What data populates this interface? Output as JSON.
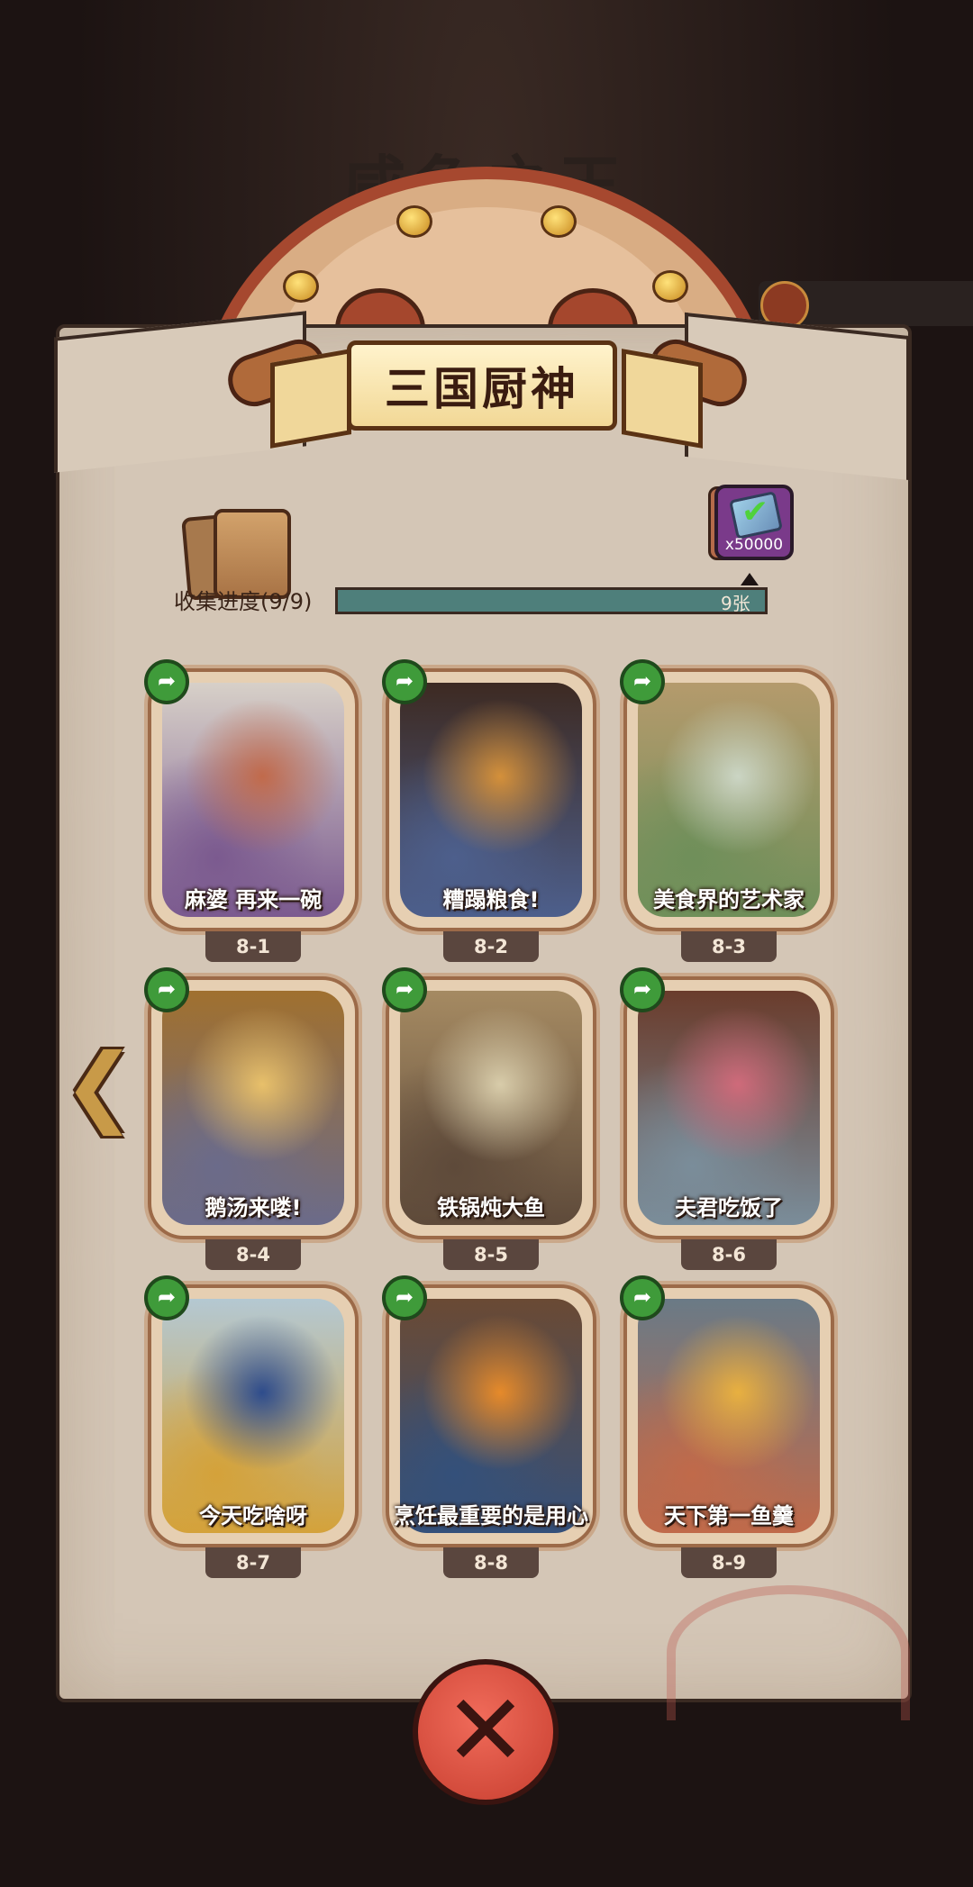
{
  "background_title": "咸鱼之王",
  "title": "三国厨神",
  "progress": {
    "label": "收集进度(9/9)",
    "collected": 9,
    "total": 9,
    "count_text": "9张",
    "reward_quantity": "x50000"
  },
  "cards": [
    {
      "caption": "麻婆 再来一碗",
      "number": "8-1",
      "art_colors": [
        "#d7d0c8",
        "#c16a4b",
        "#7b5a8f"
      ]
    },
    {
      "caption": "糟蹋粮食!",
      "number": "8-2",
      "art_colors": [
        "#3d2a22",
        "#d4903a",
        "#4d5f8c"
      ]
    },
    {
      "caption": "美食界的艺术家",
      "number": "8-3",
      "art_colors": [
        "#b49a6c",
        "#cbd5c4",
        "#6f8f5a"
      ]
    },
    {
      "caption": "鹅汤来喽!",
      "number": "8-4",
      "art_colors": [
        "#a0702f",
        "#e8c06a",
        "#6b6b8a"
      ]
    },
    {
      "caption": "铁锅炖大鱼",
      "number": "8-5",
      "art_colors": [
        "#a58a62",
        "#d8ccaa",
        "#5e4a3a"
      ]
    },
    {
      "caption": "夫君吃饭了",
      "number": "8-6",
      "art_colors": [
        "#6a3c2c",
        "#cf6a7a",
        "#7a8d9a"
      ]
    },
    {
      "caption": "今天吃啥呀",
      "number": "8-7",
      "art_colors": [
        "#b4c8d2",
        "#2e4c8c",
        "#d4a23a"
      ]
    },
    {
      "caption": "烹饪最重要的是用心",
      "number": "8-8",
      "art_colors": [
        "#6a4a34",
        "#e68a2a",
        "#34507a"
      ]
    },
    {
      "caption": "天下第一鱼羹",
      "number": "8-9",
      "art_colors": [
        "#6a7a86",
        "#e8b040",
        "#c06a4a"
      ]
    }
  ],
  "colors": {
    "paper": "#d4c6b6",
    "progress_fill": "#4e7f7b",
    "share_button": "#3f9b3a",
    "close_button": "#d94c3c"
  },
  "icons": {
    "share": "share-arrow-icon",
    "back": "chevron-left-icon",
    "close": "close-icon"
  }
}
